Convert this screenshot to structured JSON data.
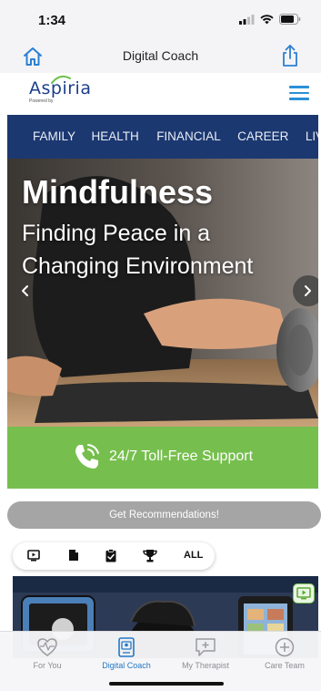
{
  "status": {
    "time": "1:34"
  },
  "nav": {
    "title": "Digital Coach"
  },
  "site": {
    "logo_text": "Aspiria",
    "logo_sub": "Powered by",
    "categories": [
      "FAMILY",
      "HEALTH",
      "FINANCIAL",
      "CAREER",
      "LIVI"
    ]
  },
  "hero": {
    "title": "Mindfulness",
    "subtitle": "Finding Peace in a Changing Environment"
  },
  "support": {
    "label": "24/7 Toll-Free Support"
  },
  "recommendations": {
    "label": "Get Recommendations!"
  },
  "filters": {
    "icons": [
      "video-icon",
      "document-icon",
      "checklist-icon",
      "trophy-icon"
    ],
    "all_label": "ALL"
  },
  "tabs": [
    {
      "label": "For You",
      "icon": "heart-pulse-icon",
      "active": false
    },
    {
      "label": "Digital Coach",
      "icon": "digital-coach-icon",
      "active": true
    },
    {
      "label": "My Therapist",
      "icon": "therapist-chat-icon",
      "active": false
    },
    {
      "label": "Care Team",
      "icon": "plus-circle-icon",
      "active": false
    }
  ],
  "colors": {
    "brand_blue": "#1c3870",
    "accent_blue": "#2378c7",
    "support_green": "#76bf4e",
    "button_gray": "#a5a5a5"
  }
}
